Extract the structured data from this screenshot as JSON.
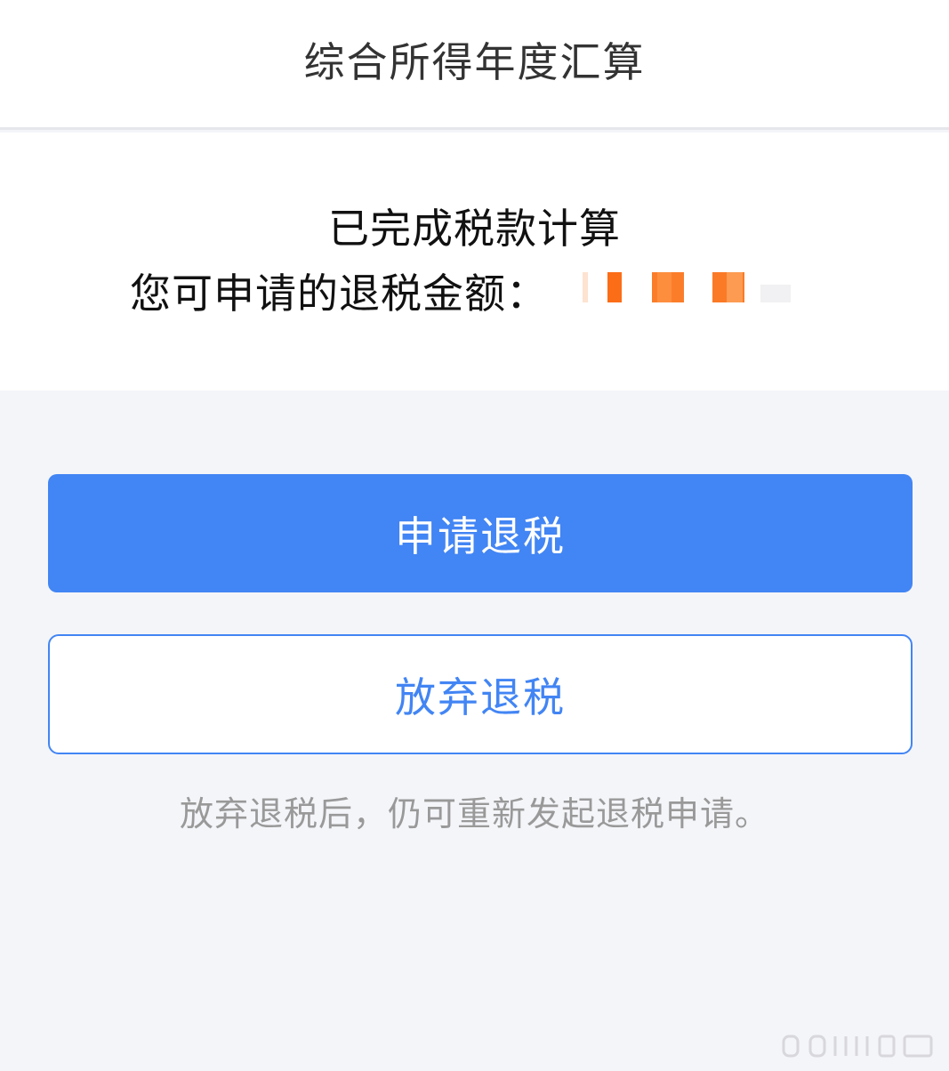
{
  "header": {
    "title": "综合所得年度汇算"
  },
  "result": {
    "status": "已完成税款计算",
    "amount_label": "您可申请的退税金额："
  },
  "actions": {
    "apply_label": "申请退税",
    "abandon_label": "放弃退税"
  },
  "hint": "放弃退税后，仍可重新发起退税申请。",
  "colors": {
    "primary": "#4285f4",
    "amount_mosaic": "#fb6d17",
    "hint": "#999999"
  }
}
